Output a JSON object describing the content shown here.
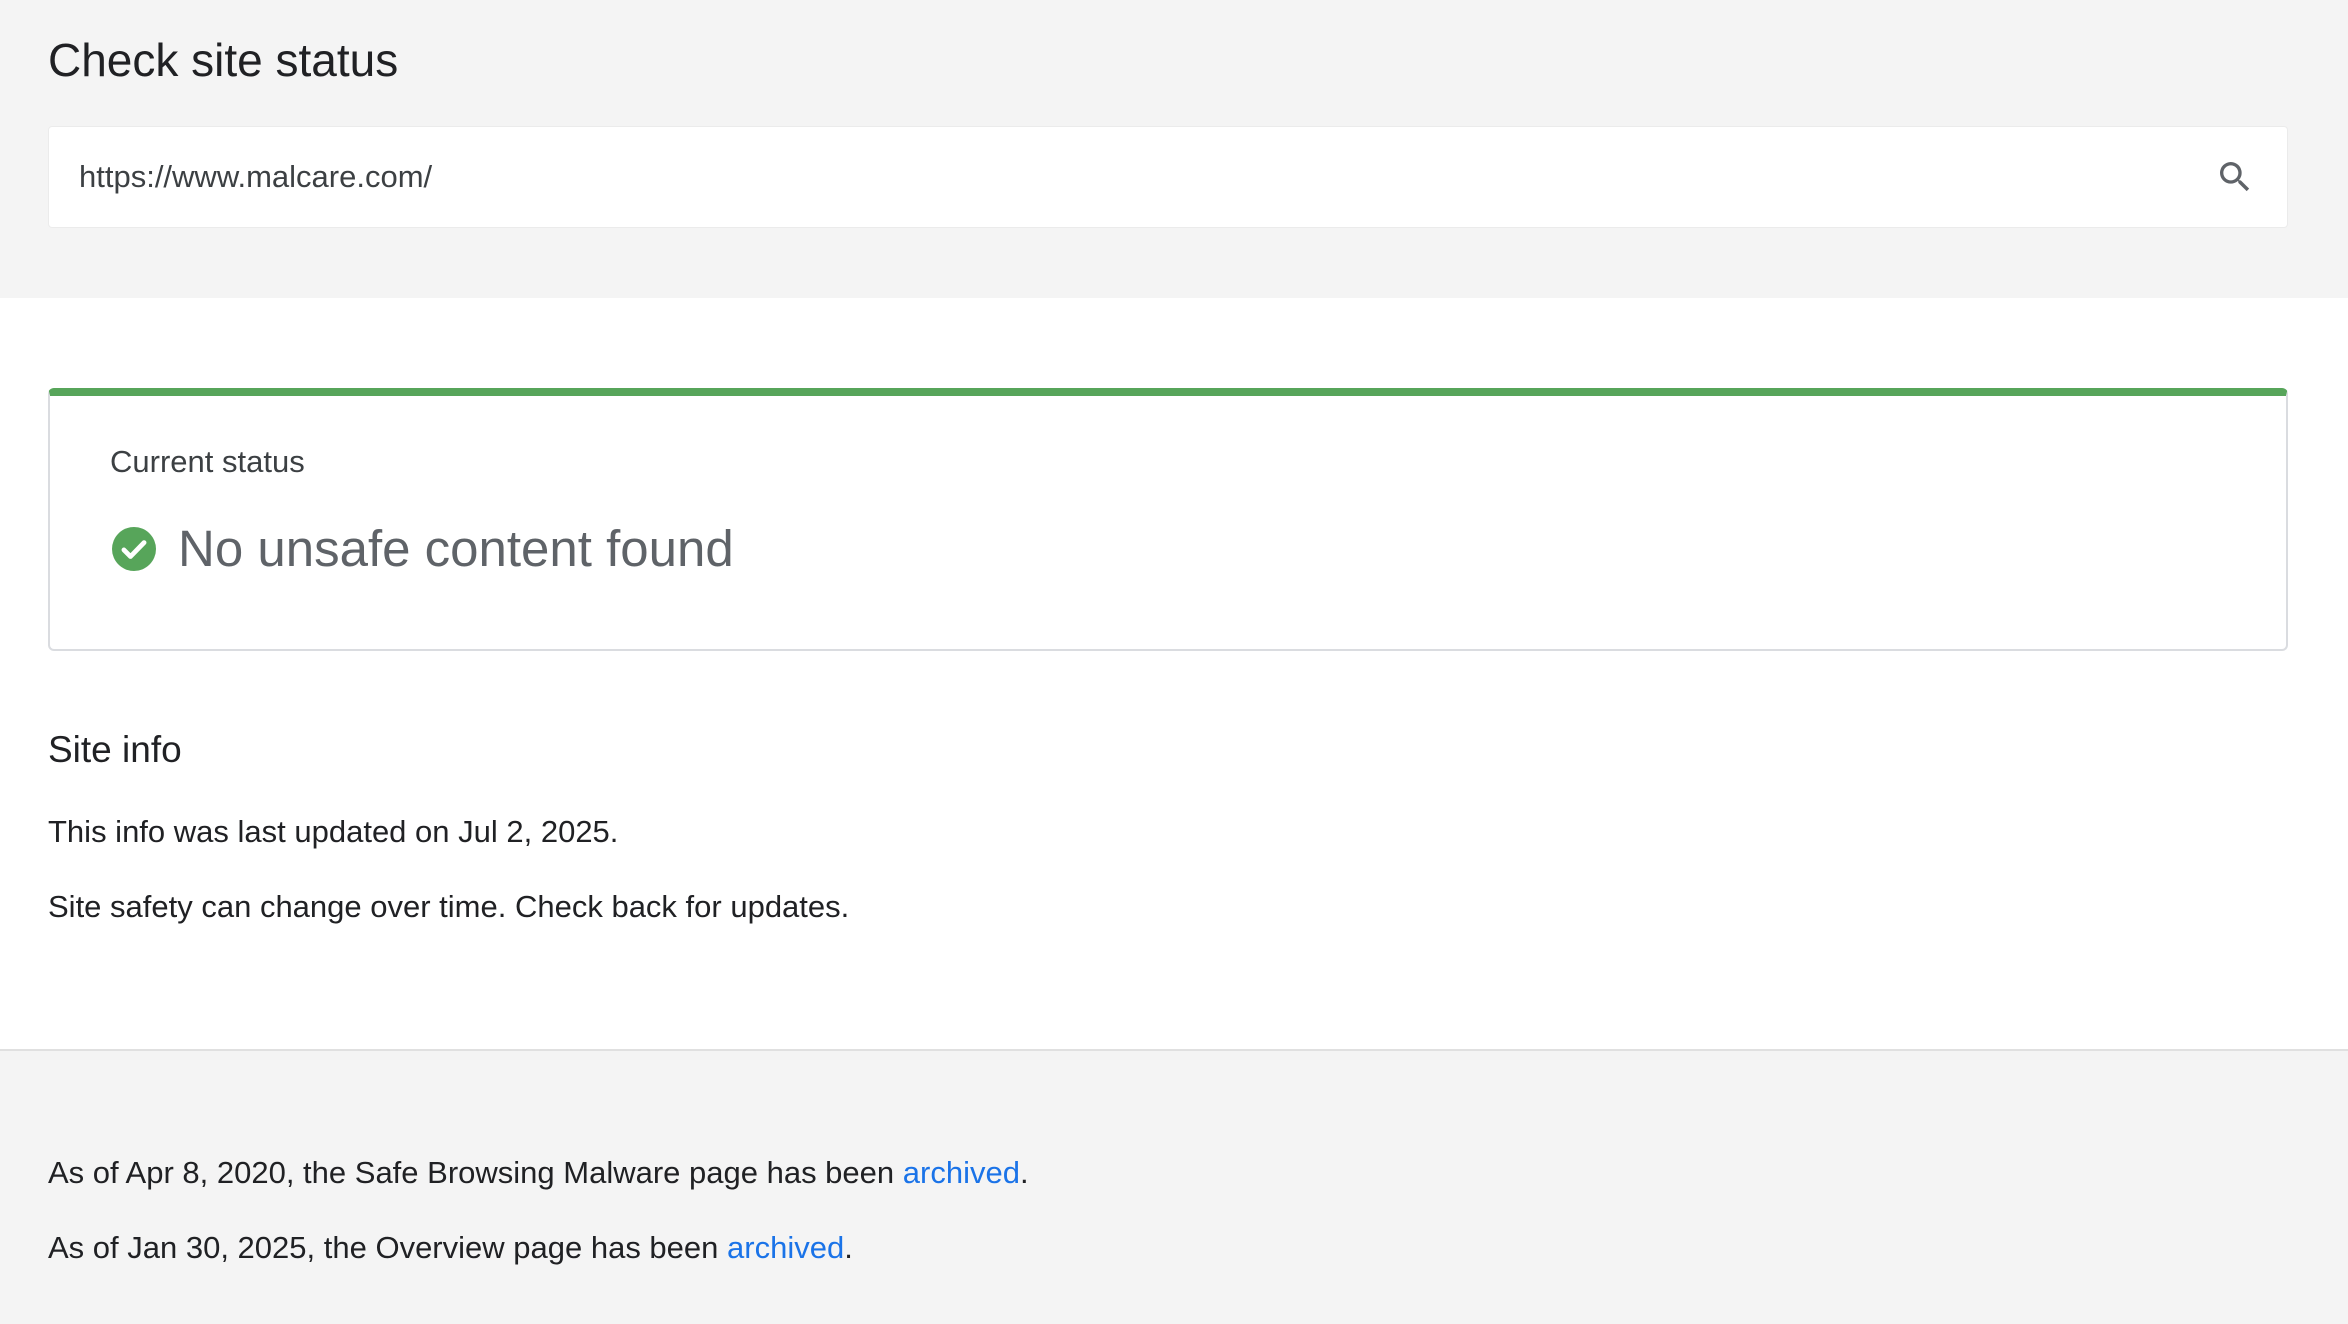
{
  "header": {
    "title": "Check site status"
  },
  "search": {
    "value": "https://www.malcare.com/",
    "icon": "search-icon"
  },
  "status": {
    "label": "Current status",
    "text": "No unsafe content found",
    "icon": "check-circle-icon",
    "accent_color": "#57a55a"
  },
  "site_info": {
    "title": "Site info",
    "updated": "This info was last updated on Jul 2, 2025.",
    "note": "Site safety can change over time. Check back for updates."
  },
  "footer": {
    "line1_prefix": "As of Apr 8, 2020, the Safe Browsing Malware page has been ",
    "line1_link": "archived",
    "line1_suffix": ".",
    "line2_prefix": "As of Jan 30, 2025, the Overview page has been ",
    "line2_link": "archived",
    "line2_suffix": ".",
    "link_color": "#1a73e8"
  }
}
